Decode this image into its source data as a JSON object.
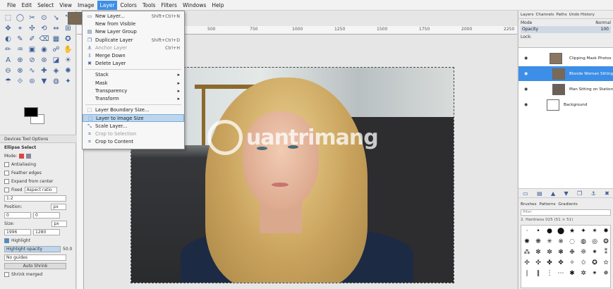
{
  "menubar": [
    "File",
    "Edit",
    "Select",
    "View",
    "Image",
    "Layer",
    "Colors",
    "Tools",
    "Filters",
    "Windows",
    "Help"
  ],
  "menubar_active": "Layer",
  "layer_menu": [
    {
      "label": "New Layer...",
      "shortcut": "Shift+Ctrl+N",
      "icon": "new-layer-icon",
      "glyph": "▭"
    },
    {
      "label": "New from Visible",
      "shortcut": "",
      "icon": "",
      "glyph": ""
    },
    {
      "label": "New Layer Group",
      "shortcut": "",
      "icon": "layer-group-icon",
      "glyph": "▤"
    },
    {
      "label": "Duplicate Layer",
      "shortcut": "Shift+Ctrl+D",
      "icon": "duplicate-icon",
      "glyph": "❐"
    },
    {
      "label": "Anchor Layer",
      "shortcut": "Ctrl+H",
      "icon": "anchor-icon",
      "glyph": "⚓",
      "disabled": true
    },
    {
      "label": "Merge Down",
      "shortcut": "",
      "icon": "merge-icon",
      "glyph": "⇩"
    },
    {
      "label": "Delete Layer",
      "shortcut": "",
      "icon": "delete-icon",
      "glyph": "✖"
    },
    {
      "label": "Stack",
      "submenu": true
    },
    {
      "label": "Mask",
      "submenu": true
    },
    {
      "label": "Transparency",
      "submenu": true
    },
    {
      "label": "Transform",
      "submenu": true
    },
    {
      "label": "Layer Boundary Size...",
      "shortcut": "",
      "icon": "boundary-icon",
      "glyph": "⬚"
    },
    {
      "label": "Layer to Image Size",
      "shortcut": "",
      "icon": "to-image-size-icon",
      "glyph": "⬚",
      "highlighted": true
    },
    {
      "label": "Scale Layer...",
      "shortcut": "",
      "icon": "scale-icon",
      "glyph": "⤡"
    },
    {
      "label": "Crop to Selection",
      "shortcut": "",
      "icon": "crop-icon",
      "glyph": "⌗",
      "disabled": true
    },
    {
      "label": "Crop to Content",
      "shortcut": "",
      "icon": "crop-content-icon",
      "glyph": "⌗"
    }
  ],
  "ruler_marks": [
    "500",
    "750",
    "1000",
    "1250",
    "1500",
    "1750",
    "2000",
    "2250"
  ],
  "tool_options": {
    "tabs": "Devices  Tool Options",
    "title": "Ellipse Select",
    "mode": "Mode:",
    "antialiasing": "Antialiasing",
    "feather": "Feather edges",
    "expand": "Expand from center",
    "fixed": "Fixed",
    "aspect": "Aspect ratio",
    "ratio": "1:2",
    "position": "Position:",
    "pos_unit": "px",
    "pos_x": "0",
    "pos_y": "0",
    "size": "Size:",
    "size_unit": "px",
    "size_w": "1996",
    "size_h": "1280",
    "highlight": "Highlight",
    "highlight_opacity": "Highlight opacity",
    "highlight_value": "50.0",
    "guides": "No guides",
    "autoshrink": "Auto Shrink",
    "shrink_merged": "Shrink merged"
  },
  "watermark": "uantrimang",
  "right_panel": {
    "tabs": [
      "Layers",
      "Channels",
      "Paths",
      "Undo History"
    ],
    "mode_label": "Mode",
    "mode_value": "Normal",
    "opacity_label": "Opacity",
    "opacity_value": "100",
    "lock_label": "Lock:",
    "layers": [
      {
        "name": "Clipping Mask Photos",
        "selected": false
      },
      {
        "name": "Blonde Woman Sitting",
        "selected": true
      },
      {
        "name": "Man Sitting on Station",
        "selected": false
      },
      {
        "name": "Background",
        "selected": false
      }
    ],
    "brush_tabs": [
      "Brushes",
      "Patterns",
      "Gradients"
    ],
    "brush_filter": "filter",
    "brush_label": "2. Hardness 025 (51 × 51)"
  },
  "accent_color": "#3d8ee6"
}
